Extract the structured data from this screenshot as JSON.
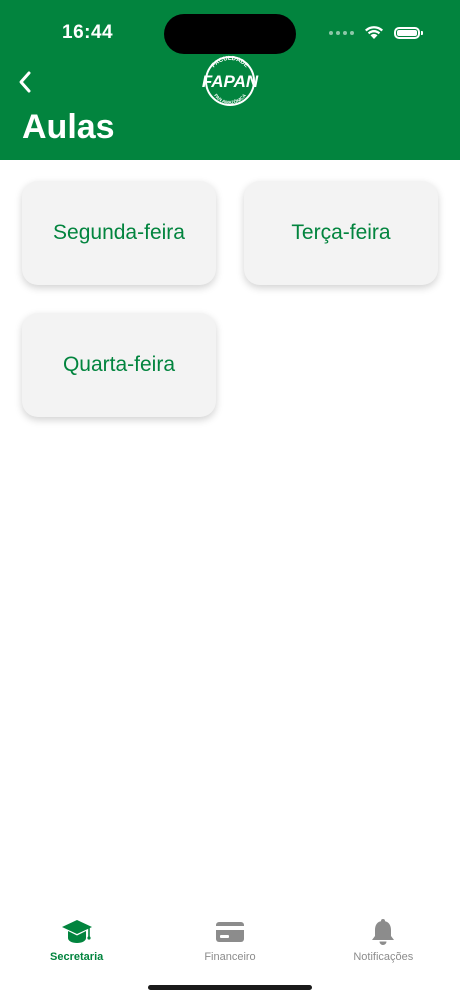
{
  "status_bar": {
    "time": "16:44"
  },
  "header": {
    "logo": {
      "arc_text_top": "FACULDADE",
      "name": "FAPAN",
      "arc_text_bottom": "PAN AMAZÔNICA"
    },
    "title": "Aulas",
    "back_icon": "chevron-left-icon"
  },
  "days": [
    {
      "label": "Segunda-feira"
    },
    {
      "label": "Terça-feira"
    },
    {
      "label": "Quarta-feira"
    }
  ],
  "tabbar": {
    "tabs": [
      {
        "label": "Secretaria",
        "icon": "graduation-cap-icon",
        "active": true
      },
      {
        "label": "Financeiro",
        "icon": "credit-card-icon",
        "active": false
      },
      {
        "label": "Notificações",
        "icon": "bell-icon",
        "active": false
      }
    ]
  },
  "colors": {
    "brand_green": "#02843e",
    "card_background": "#f3f3f3",
    "inactive_tab": "#8c8c8c"
  }
}
